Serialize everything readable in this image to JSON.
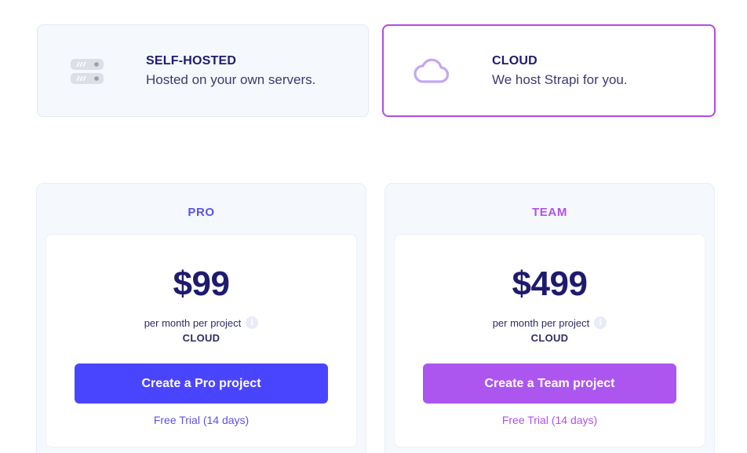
{
  "hosting": {
    "self": {
      "title": "SELF-HOSTED",
      "subtitle": "Hosted on your own servers.",
      "icon": "server-icon"
    },
    "cloud": {
      "title": "CLOUD",
      "subtitle": "We host Strapi for you.",
      "icon": "cloud-icon",
      "selected": true
    }
  },
  "plans": [
    {
      "name": "PRO",
      "price": "$99",
      "period": "per month per project",
      "deployment": "CLOUD",
      "cta": "Create a Pro project",
      "trial": "Free Trial (14 days)",
      "accent": "#4945ff"
    },
    {
      "name": "TEAM",
      "price": "$499",
      "period": "per month per project",
      "deployment": "CLOUD",
      "cta": "Create a Team project",
      "trial": "Free Trial (14 days)",
      "accent": "#ac56ef"
    }
  ],
  "colors": {
    "selected_border": "#b34be0",
    "text_dark": "#1e1b6e",
    "card_bg": "#f5f8fc"
  }
}
